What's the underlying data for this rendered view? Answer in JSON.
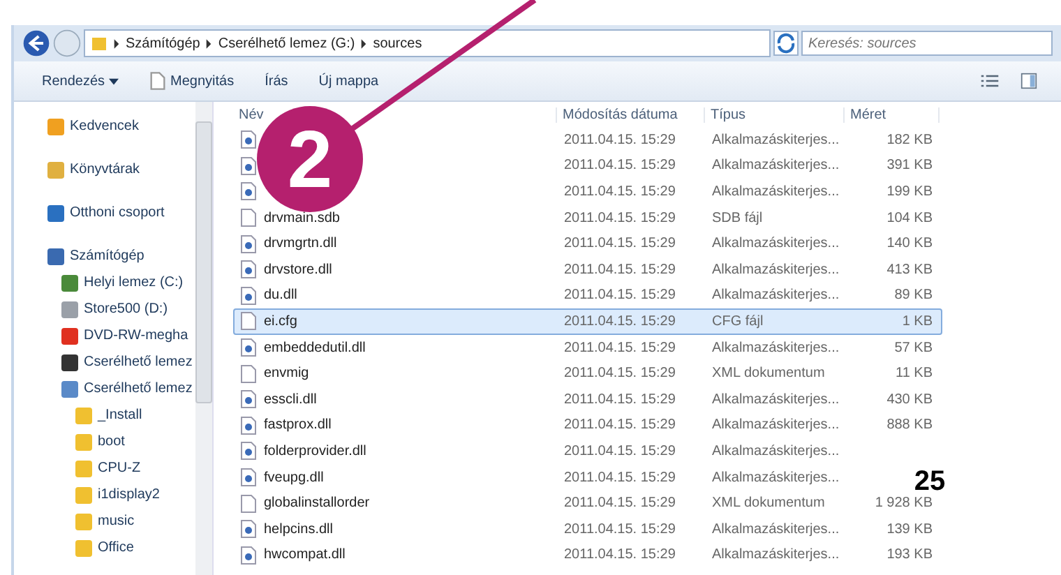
{
  "address_bar": {
    "path": [
      "Számítógép",
      "Cserélhető lemez (G:)",
      "sources"
    ],
    "search_placeholder": "Keresés: sources"
  },
  "toolbar": {
    "buttons": [
      {
        "label": "Rendezés",
        "kind": "menu"
      },
      {
        "label": "Megnyitás",
        "kind": "open"
      },
      {
        "label": "Írás",
        "kind": "plain"
      },
      {
        "label": "Új mappa",
        "kind": "plain"
      }
    ]
  },
  "sidebar": {
    "items": [
      {
        "label": "Kedvencek",
        "kind": "star"
      },
      {
        "label": "Könyvtárak",
        "kind": "library"
      },
      {
        "label": "Otthoni csoport",
        "kind": "homegroup"
      },
      {
        "label": "Számítógép",
        "kind": "computer",
        "children": [
          {
            "label": "Helyi lemez (C:)",
            "kind": "windisk"
          },
          {
            "label": "Store500 (D:)",
            "kind": "disk"
          },
          {
            "label": "DVD-RW-megha",
            "kind": "dvd"
          },
          {
            "label": "Cserélhető lemez",
            "kind": "removable"
          },
          {
            "label": "Cserélhető lemez",
            "kind": "usb",
            "children": [
              {
                "label": "_Install",
                "kind": "folder"
              },
              {
                "label": "boot",
                "kind": "folder"
              },
              {
                "label": "CPU-Z",
                "kind": "folder"
              },
              {
                "label": "i1display2",
                "kind": "folder"
              },
              {
                "label": "music",
                "kind": "folder"
              },
              {
                "label": "Office",
                "kind": "folder"
              }
            ]
          }
        ]
      }
    ]
  },
  "table": {
    "columns": [
      "Név",
      "Módosítás dátuma",
      "Típus",
      "Méret"
    ],
    "rows": [
      {
        "kind": "dll",
        "date": "2011.04.15. 15:29",
        "type": "Alkalmazáskiterjes...",
        "size": "182 KB",
        "selected": false
      },
      {
        "kind": "dll",
        "date": "2011.04.15. 15:29",
        "type": "Alkalmazáskiterjes...",
        "size": "391 KB",
        "selected": false
      },
      {
        "kind": "dll",
        "date": "2011.04.15. 15:29",
        "type": "Alkalmazáskiterjes...",
        "size": "199 KB",
        "selected": false
      },
      {
        "kind": "file",
        "name": "drvmain.sdb",
        "date": "2011.04.15. 15:29",
        "type": "SDB fájl",
        "size": "104 KB",
        "selected": false
      },
      {
        "kind": "dll",
        "name": "drvmgrtn.dll",
        "date": "2011.04.15. 15:29",
        "type": "Alkalmazáskiterjes...",
        "size": "140 KB",
        "selected": false
      },
      {
        "kind": "dll",
        "name": "drvstore.dll",
        "date": "2011.04.15. 15:29",
        "type": "Alkalmazáskiterjes...",
        "size": "413 KB",
        "selected": false
      },
      {
        "kind": "dll",
        "name": "du.dll",
        "date": "2011.04.15. 15:29",
        "type": "Alkalmazáskiterjes...",
        "size": "89 KB",
        "selected": false
      },
      {
        "kind": "file",
        "name": "ei.cfg",
        "date": "2011.04.15. 15:29",
        "type": "CFG fájl",
        "size": "1 KB",
        "selected": true
      },
      {
        "kind": "dll",
        "name": "embeddedutil.dll",
        "date": "2011.04.15. 15:29",
        "type": "Alkalmazáskiterjes...",
        "size": "57 KB",
        "selected": false
      },
      {
        "kind": "file",
        "name": "envmig",
        "date": "2011.04.15. 15:29",
        "type": "XML dokumentum",
        "size": "11 KB",
        "selected": false
      },
      {
        "kind": "dll",
        "name": "esscli.dll",
        "date": "2011.04.15. 15:29",
        "type": "Alkalmazáskiterjes...",
        "size": "430 KB",
        "selected": false
      },
      {
        "kind": "dll",
        "name": "fastprox.dll",
        "date": "2011.04.15. 15:29",
        "type": "Alkalmazáskiterjes...",
        "size": "888 KB",
        "selected": false
      },
      {
        "kind": "dll",
        "name": "folderprovider.dll",
        "date": "2011.04.15. 15:29",
        "type": "Alkalmazáskiterjes...",
        "selected": false
      },
      {
        "kind": "dll",
        "name": "fveupg.dll",
        "date": "2011.04.15. 15:29",
        "type": "Alkalmazáskiterjes...",
        "selected": false
      },
      {
        "kind": "file",
        "name": "globalinstallorder",
        "date": "2011.04.15. 15:29",
        "type": "XML dokumentum",
        "size": "1 928 KB",
        "selected": false
      },
      {
        "kind": "dll",
        "name": "helpcins.dll",
        "date": "2011.04.15. 15:29",
        "type": "Alkalmazáskiterjes...",
        "size": "139 KB",
        "selected": false
      },
      {
        "kind": "dll",
        "name": "hwcompat.dll",
        "date": "2011.04.15. 15:29",
        "type": "Alkalmazáskiterjes...",
        "size": "193 KB",
        "selected": false
      }
    ]
  },
  "callout": {
    "number": "2"
  },
  "page_number": "25"
}
